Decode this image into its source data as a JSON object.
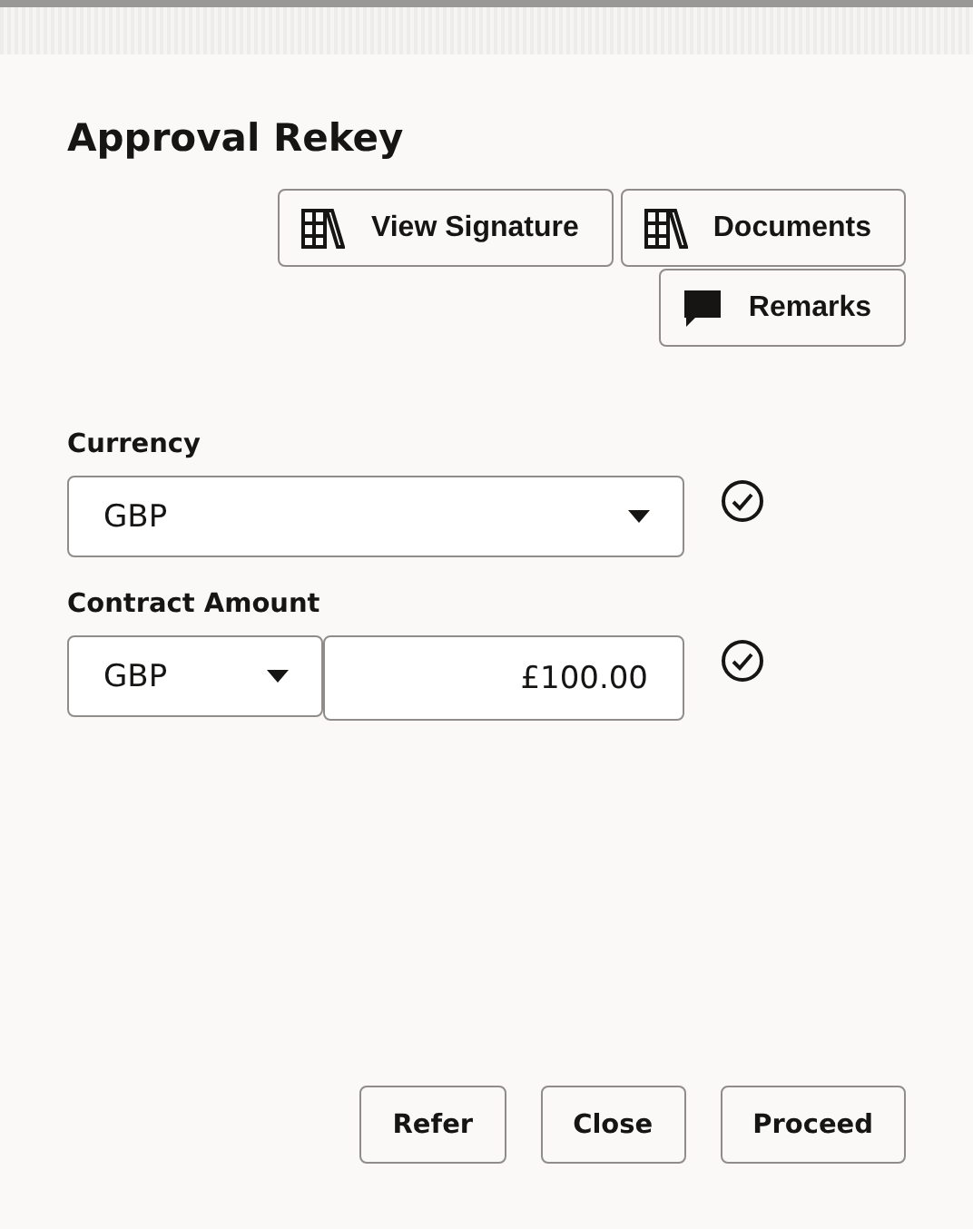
{
  "title": "Approval Rekey",
  "actions": [
    {
      "label": "View Signature",
      "kind": "books"
    },
    {
      "label": "Documents",
      "kind": "books"
    },
    {
      "label": "Remarks",
      "kind": "comment"
    }
  ],
  "currency": {
    "label": "Currency",
    "value": "GBP",
    "validated": true
  },
  "contract_amount": {
    "label": "Contract Amount",
    "currency": "GBP",
    "amount": "£100.00",
    "validated": true
  },
  "footer_buttons": [
    "Refer",
    "Close",
    "Proceed"
  ]
}
